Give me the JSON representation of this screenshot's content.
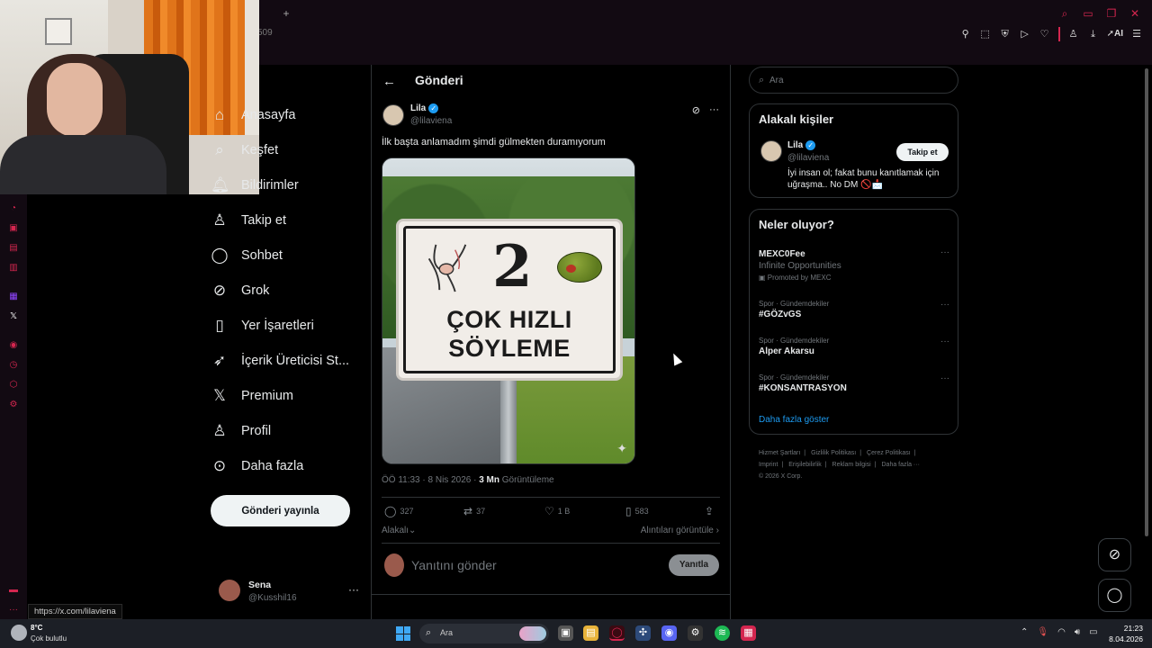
{
  "browser": {
    "tab_add": "+",
    "tab_count": "509",
    "window_controls": [
      "search-icon",
      "minimize-icon",
      "restore-icon",
      "close-icon"
    ],
    "toolbar_icons": [
      "pin-icon",
      "snapshot-icon",
      "shield-icon",
      "play-icon",
      "heart-icon",
      "user-icon",
      "download-icon",
      "send-icon",
      "menu-icon"
    ],
    "toolbar_ai_label": "AI",
    "accent": "#d4264f"
  },
  "nav": {
    "items": [
      {
        "label": "Anasayfa",
        "icon": "home-icon"
      },
      {
        "label": "Keşfet",
        "icon": "search-icon"
      },
      {
        "label": "Bildirimler",
        "icon": "bell-icon"
      },
      {
        "label": "Takip et",
        "icon": "follow-icon"
      },
      {
        "label": "Sohbet",
        "icon": "chat-icon"
      },
      {
        "label": "Grok",
        "icon": "grok-icon"
      },
      {
        "label": "Yer İşaretleri",
        "icon": "bookmark-icon"
      },
      {
        "label": "İçerik Üreticisi St...",
        "icon": "rocket-icon"
      },
      {
        "label": "Premium",
        "icon": "x-logo-icon"
      },
      {
        "label": "Profil",
        "icon": "profile-icon"
      },
      {
        "label": "Daha fazla",
        "icon": "more-circle-icon"
      }
    ],
    "post_button": "Gönderi yayınla",
    "account": {
      "name": "Sena",
      "handle": "@Kusshil16",
      "more": "···"
    }
  },
  "post": {
    "header_title": "Gönderi",
    "author_name": "Lila",
    "author_handle": "@lilaviena",
    "text": "İlk başta anlamadım şimdi gülmekten duramıyorum",
    "image": {
      "number": "2",
      "line1": "ÇOK HIZLI",
      "line2": "SÖYLEME"
    },
    "time": "ÖÖ 11:33",
    "date": "8 Nis 2026",
    "views_count": "3 Mn",
    "views_label": "Görüntüleme",
    "stats": {
      "replies": "327",
      "reposts": "37",
      "likes": "1 B",
      "bookmarks": "583"
    },
    "related_label": "Alakalı",
    "quotes_label": "Alıntıları görüntüle",
    "reply_placeholder": "Yanıtını gönder",
    "reply_button": "Yanıtla"
  },
  "sidebar": {
    "search_placeholder": "Ara",
    "relevant_title": "Alakalı kişiler",
    "suggested": {
      "name": "Lila",
      "handle": "@lilaviena",
      "follow_label": "Takip et",
      "bio": "İyi insan ol; fakat bunu kanıtlamak için uğraşma.. No DM 🚫📩"
    },
    "trends_title": "Neler oluyor?",
    "trends": [
      {
        "category": "",
        "name": "MEXC0Fee",
        "subtitle": "Infinite Opportunities",
        "promo": "Promoted by MEXC"
      },
      {
        "category": "Spor · Gündemdekiler",
        "name": "#GÖZvGS"
      },
      {
        "category": "Spor · Gündemdekiler",
        "name": "Alper Akarsu"
      },
      {
        "category": "Spor · Gündemdekiler",
        "name": "#KONSANTRASYON"
      }
    ],
    "show_more": "Daha fazla göster",
    "footer": [
      "Hizmet Şartları",
      "|",
      "Gizlilik Politikası",
      "|",
      "Çerez Politikası",
      "|",
      "Imprint",
      "|",
      "Erişilebilirlik",
      "|",
      "Reklam bilgisi",
      "|",
      "Daha fazla ···",
      "© 2026 X Corp."
    ]
  },
  "status_url": "https://x.com/lilaviena",
  "taskbar": {
    "weather_temp": "8°C",
    "weather_condition": "Çok bulutlu",
    "search_placeholder": "Ara",
    "time": "21:23",
    "date": "8.04.2026"
  }
}
